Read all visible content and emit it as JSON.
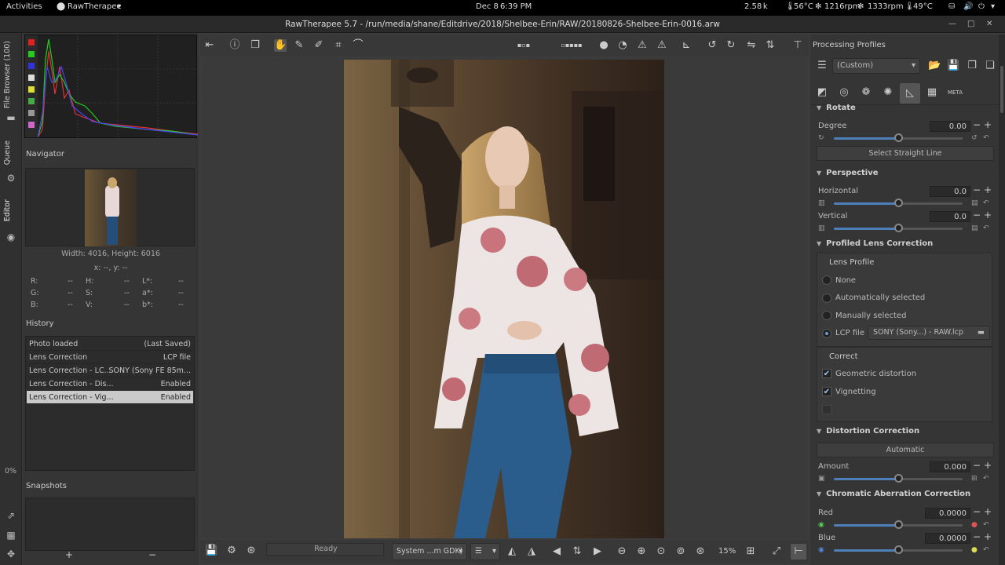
{
  "system_bar": {
    "activities": "Activities",
    "app_menu": "RawTherapee",
    "date": "Dec 8",
    "time": "6:39 PM",
    "net_speed": "2.58 k",
    "temp1": "56°C",
    "fan1": "1216rpm",
    "fan2": "1333rpm",
    "temp2": "49°C"
  },
  "window": {
    "title": "RawTherapee 5.7 - /run/media/shane/Editdrive/2018/Shelbee-Erin/RAW/20180826-Shelbee-Erin-0016.arw"
  },
  "side_tabs": {
    "file_browser": "File Browser (100)",
    "queue": "Queue",
    "editor": "Editor",
    "percent": "0%"
  },
  "navigator": {
    "title": "Navigator",
    "dimensions": "Width: 4016, Height: 6016",
    "coords": "x: --, y: --",
    "readouts": [
      {
        "label": "R:",
        "value": "--"
      },
      {
        "label": "H:",
        "value": "--"
      },
      {
        "label": "L*:",
        "value": "--"
      },
      {
        "label": "G:",
        "value": "--"
      },
      {
        "label": "S:",
        "value": "--"
      },
      {
        "label": "a*:",
        "value": "--"
      },
      {
        "label": "B:",
        "value": "--"
      },
      {
        "label": "V:",
        "value": "--"
      },
      {
        "label": "b*:",
        "value": "--"
      }
    ]
  },
  "history": {
    "title": "History",
    "rows": [
      {
        "name": "Photo loaded",
        "value": "(Last Saved)"
      },
      {
        "name": "Lens Correction",
        "value": "LCP file"
      },
      {
        "name": "Lens Correction - LC...",
        "value": "SONY (Sony FE 85m..."
      },
      {
        "name": "Lens Correction - Dis...",
        "value": "Enabled"
      },
      {
        "name": "Lens Correction - Vig...",
        "value": "Enabled"
      }
    ]
  },
  "snapshots": {
    "title": "Snapshots",
    "add": "+",
    "remove": "−"
  },
  "bottom": {
    "status": "Ready",
    "profile_select": "System ...m GDK)",
    "zoom": "15%"
  },
  "right": {
    "title": "Processing Profiles",
    "profile": "(Custom)",
    "rotate": {
      "title": "Rotate",
      "degree_label": "Degree",
      "degree_value": "0.00",
      "degree_fraction": 0.5,
      "select_line": "Select Straight Line"
    },
    "perspective": {
      "title": "Perspective",
      "horizontal_label": "Horizontal",
      "horizontal_value": "0.0",
      "horizontal_fraction": 0.5,
      "vertical_label": "Vertical",
      "vertical_value": "0.0",
      "vertical_fraction": 0.5
    },
    "lens": {
      "title": "Profiled Lens Correction",
      "profile_group": "Lens Profile",
      "options": [
        "None",
        "Automatically selected",
        "Manually selected"
      ],
      "lcp_label": "LCP file",
      "lcp_value": "SONY (Sony...) - RAW.lcp",
      "correct_group": "Correct",
      "geometric": "Geometric distortion",
      "vignetting": "Vignetting"
    },
    "distortion": {
      "title": "Distortion Correction",
      "auto": "Automatic",
      "amount_label": "Amount",
      "amount_value": "0.000",
      "amount_fraction": 0.5
    },
    "ca": {
      "title": "Chromatic Aberration Correction",
      "red_label": "Red",
      "red_value": "0.0000",
      "red_fraction": 0.5,
      "blue_label": "Blue",
      "blue_value": "0.0000",
      "blue_fraction": 0.5
    }
  },
  "colors": {
    "accent": "#4d7fb8",
    "background": "#3c3c3c",
    "panel": "#353535"
  }
}
